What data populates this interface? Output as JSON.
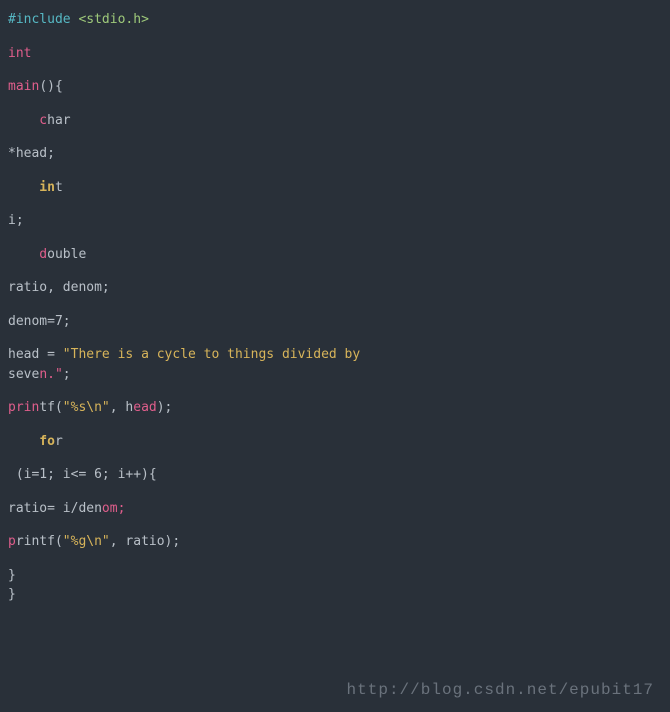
{
  "code": {
    "l1a": "#include ",
    "l1b": "<stdio.h>",
    "l2": "int",
    "l3a": "main",
    "l3b": "(){",
    "l4a": "    c",
    "l4b": "har",
    "l5": "*head;",
    "l6a": "    in",
    "l6b": "t",
    "l7": "i;",
    "l8a": "    d",
    "l8b": "ouble",
    "l9": "ratio, denom;",
    "l10": "denom=7;",
    "l11a": "head = ",
    "l11b": "\"There is a cycle to things divided by",
    "l12a": "seve",
    "l12b": "n.\"",
    "l12c": ";",
    "l13a": "prin",
    "l13b": "tf(",
    "l13c": "\"%s\\n\"",
    "l13d": ", h",
    "l13e": "ead",
    "l13f": ");",
    "l14a": "    fo",
    "l14b": "r",
    "l15": " (i=1; i<= 6; i++){",
    "l16a": "ratio= i/den",
    "l16b": "om;",
    "l17a": "p",
    "l17b": "rintf(",
    "l17c": "\"%g\\n\"",
    "l17d": ", ratio);",
    "l18": "}",
    "l19": "}"
  },
  "watermark": "http://blog.csdn.net/epubit17"
}
